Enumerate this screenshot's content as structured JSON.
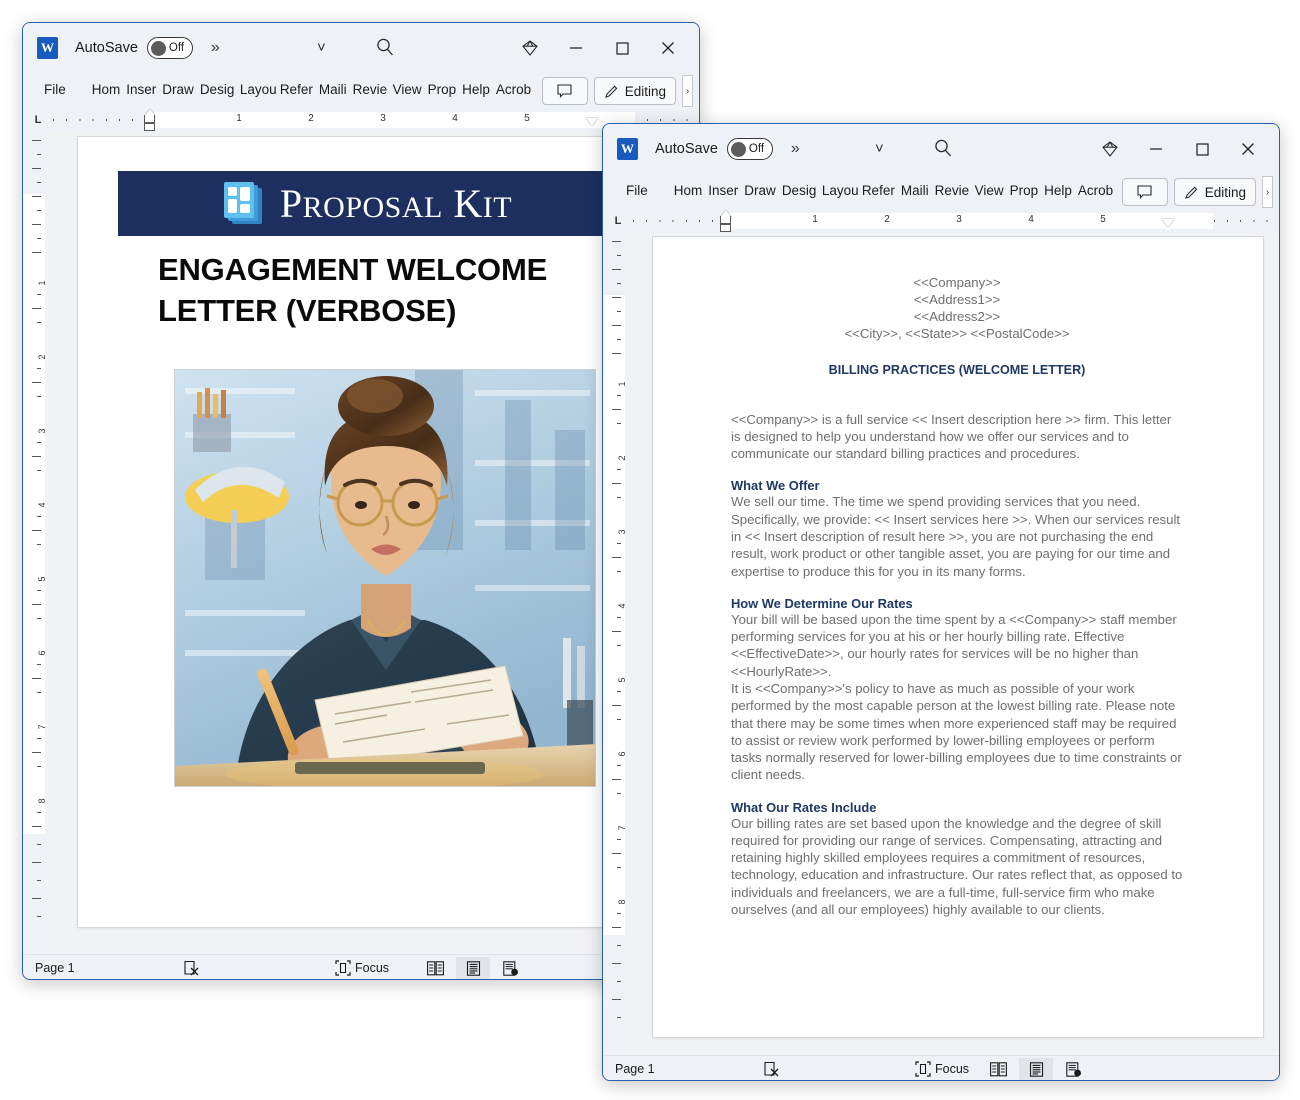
{
  "app": {
    "name": "Microsoft Word",
    "logo_letter": "W"
  },
  "accent_colors": {
    "window_border": "#2560a8",
    "word_blue": "#185abd",
    "banner_navy": "#1c2f5e",
    "heading_navy": "#1f3864",
    "body_gray": "#6f6f6f",
    "chrome_bg": "#eef1f5"
  },
  "window1": {
    "titlebar": {
      "autosave_label": "AutoSave",
      "autosave_state": "Off",
      "overflow_label": "»",
      "customize_icon": "chevron-down-icon",
      "search_icon": "search-icon",
      "diamond_icon": "diamond-icon",
      "minimize_icon": "minimize-icon",
      "maximize_icon": "maximize-icon",
      "close_icon": "close-icon"
    },
    "ribbon": {
      "tabs": [
        "File",
        "Home",
        "Insert",
        "Draw",
        "Design",
        "Layout",
        "References",
        "Mailings",
        "Review",
        "View",
        "Properties",
        "Help",
        "Acrobat"
      ],
      "tabs_visible": [
        "File",
        "Hom",
        "Inser",
        "Draw",
        "Desig",
        "Layou",
        "Refer",
        "Maili",
        "Revie",
        "View",
        "Prop",
        "Help",
        "Acrob"
      ],
      "comment_button": "",
      "editing_button": "Editing",
      "overflow_chevron": "›"
    },
    "ruler": {
      "tab_stop_indicator": "L",
      "numbers": [
        "1",
        "2",
        "3",
        "4",
        "5"
      ],
      "vertical_numbers": [
        "1",
        "2",
        "3",
        "4",
        "5",
        "6",
        "7",
        "8"
      ]
    },
    "document": {
      "banner_title_primary": "P",
      "banner_title": "ROPOSAL",
      "banner_title2": "K",
      "banner_title2b": "IT",
      "brand_full": "PROPOSAL KIT",
      "heading": "ENGAGEMENT WELCOME LETTER (VERBOSE)",
      "image_alt": "woman-at-desk-reviewing-document-illustration"
    },
    "statusbar": {
      "page": "Page 1",
      "proofing_icon": "proofing-errors-icon",
      "focus_label": "Focus",
      "focus_icon": "focus-icon",
      "view_read_icon": "read-mode-icon",
      "view_print_icon": "print-layout-icon",
      "view_web_icon": "web-layout-icon"
    }
  },
  "window2": {
    "titlebar": {
      "autosave_label": "AutoSave",
      "autosave_state": "Off",
      "overflow_label": "»",
      "customize_icon": "chevron-down-icon",
      "search_icon": "search-icon",
      "diamond_icon": "diamond-icon",
      "minimize_icon": "minimize-icon",
      "maximize_icon": "maximize-icon",
      "close_icon": "close-icon"
    },
    "ribbon": {
      "tabs_visible": [
        "File",
        "Hom",
        "Inser",
        "Draw",
        "Desig",
        "Layou",
        "Refer",
        "Maili",
        "Revie",
        "View",
        "Prop",
        "Help",
        "Acrob"
      ],
      "comment_button": "",
      "editing_button": "Editing",
      "overflow_chevron": "›"
    },
    "ruler": {
      "tab_stop_indicator": "L",
      "numbers": [
        "1",
        "2",
        "3",
        "4",
        "5"
      ],
      "vertical_numbers": [
        "1",
        "2",
        "3",
        "4",
        "5",
        "6",
        "7",
        "8"
      ]
    },
    "document": {
      "address_lines": [
        "<<Company>>",
        "<<Address1>>",
        "<<Address2>>",
        "<<City>>, <<State>> <<PostalCode>>"
      ],
      "subject": "BILLING PRACTICES (WELCOME LETTER)",
      "intro": "<<Company>> is a full service << Insert description here >> firm. This letter is designed to help you understand how we offer our services and to communicate our standard billing practices and procedures.",
      "sections": [
        {
          "heading": "What We Offer",
          "paragraphs": [
            "We sell our time. The time we spend providing services that you need. Specifically, we provide:  << Insert services here >>. When our services result in << Insert description of result here >>, you are not purchasing the end result, work product or other tangible asset, you are paying for our time and expertise to produce this for you in its many forms."
          ]
        },
        {
          "heading": "How We Determine Our Rates",
          "paragraphs": [
            "Your bill will be based upon the time spent by a <<Company>> staff member performing services for you at his or her hourly billing rate. Effective <<EffectiveDate>>, our hourly rates for services will be no higher than <<HourlyRate>>.",
            "It is <<Company>>'s policy to have as much as possible of your work performed by the most capable person at the lowest billing rate. Please note that there may be some times when more experienced staff may be required to assist or review work performed by lower-billing employees or perform tasks normally reserved for lower-billing employees due to time constraints or client needs."
          ]
        },
        {
          "heading": "What Our Rates Include",
          "paragraphs": [
            "Our billing rates are set based upon the knowledge and the degree of skill required for providing our range of services. Compensating, attracting and retaining highly skilled employees requires a commitment of resources, technology, education and infrastructure. Our rates reflect that, as opposed to individuals and freelancers, we are a full-time, full-service firm who make ourselves (and all our employees) highly available to our clients."
          ]
        }
      ]
    },
    "statusbar": {
      "page": "Page 1",
      "proofing_icon": "proofing-errors-icon",
      "focus_label": "Focus",
      "focus_icon": "focus-icon",
      "view_read_icon": "read-mode-icon",
      "view_print_icon": "print-layout-icon",
      "view_web_icon": "web-layout-icon"
    }
  }
}
